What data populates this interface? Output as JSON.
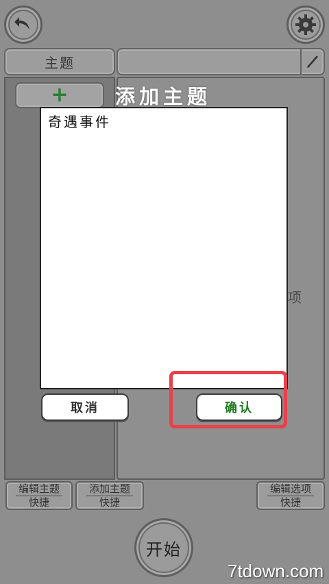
{
  "top_bar": {
    "back_icon": "back-arrow-icon",
    "settings_icon": "gear-icon",
    "pen_icon": "pen-icon"
  },
  "tabs": {
    "theme_label": "主题",
    "add_icon": "plus-icon",
    "plus_glyph": "+"
  },
  "background": {
    "right_hint": "项"
  },
  "dialog": {
    "title": "添加主题",
    "input_value": "奇遇事件",
    "cancel_label": "取消",
    "confirm_label": "确认",
    "confirm_color": "#1f7a1f",
    "highlight_color": "#e8414a"
  },
  "bottom": {
    "edit_theme_line1": "编辑主题",
    "edit_theme_line2": "快捷",
    "add_theme_line1": "添加主题",
    "add_theme_line2": "快捷",
    "edit_option_line1": "编辑选项",
    "edit_option_line2": "快捷",
    "start_label": "开始"
  },
  "watermark": "7tdown.com"
}
